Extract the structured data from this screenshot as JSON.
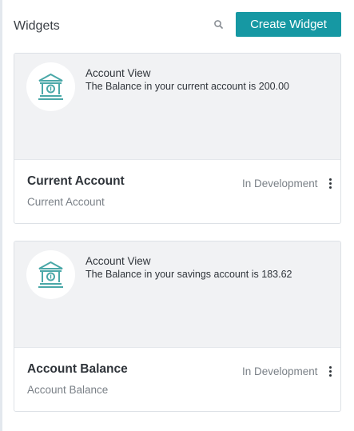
{
  "header": {
    "title": "Widgets",
    "search_icon": "search-icon",
    "create_button_label": "Create Widget"
  },
  "colors": {
    "accent": "#1698a3",
    "bank_icon": "#4aa8a8",
    "preview_bg": "#f1f2f4"
  },
  "widgets": [
    {
      "icon": "bank-icon",
      "preview_title": "Account View",
      "preview_text": "The Balance in your current account is 200.00",
      "name": "Current Account",
      "subtitle": "Current Account",
      "status": "In Development",
      "menu_icon": "more-vertical-icon"
    },
    {
      "icon": "bank-icon",
      "preview_title": "Account View",
      "preview_text": "The Balance in your savings account is 183.62",
      "name": "Account Balance",
      "subtitle": "Account Balance",
      "status": "In Development",
      "menu_icon": "more-vertical-icon"
    }
  ]
}
